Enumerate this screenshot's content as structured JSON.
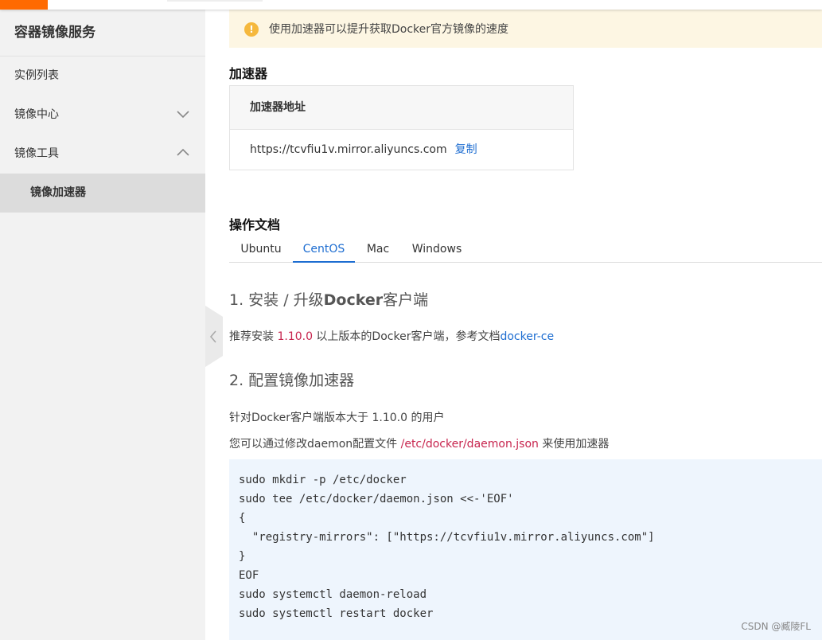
{
  "colors": {
    "accent": "#1d6dd1",
    "brand_orange": "#ff6a00",
    "code_red": "#c7254e",
    "warning": "#f5b83d"
  },
  "sidebar": {
    "title": "容器镜像服务",
    "items": [
      {
        "label": "实例列表"
      },
      {
        "label": "镜像中心",
        "icon": "chevron-down-icon"
      },
      {
        "label": "镜像工具",
        "icon": "chevron-up-icon"
      }
    ],
    "subitem": {
      "label": "镜像加速器"
    }
  },
  "notice": {
    "icon": "warning-icon",
    "text": "使用加速器可以提升获取Docker官方镜像的速度"
  },
  "accelerator": {
    "heading": "加速器",
    "table_header": "加速器地址",
    "address": "https://tcvfiu1v.mirror.aliyuncs.com",
    "copy_label": "复制"
  },
  "docs": {
    "heading": "操作文档",
    "tabs": [
      "Ubuntu",
      "CentOS",
      "Mac",
      "Windows"
    ],
    "active_tab": "CentOS",
    "step1": {
      "num": "1. 安装 / 升级",
      "bold": "Docker",
      "suffix": "客户端",
      "para_prefix": "推荐安装 ",
      "version": "1.10.0",
      "para_mid": " 以上版本的Docker客户端，参考文档",
      "link": "docker-ce"
    },
    "step2": {
      "title": "2. 配置镜像加速器",
      "para1": "针对Docker客户端版本大于 1.10.0 的用户",
      "para2_prefix": "您可以通过修改daemon配置文件 ",
      "path": "/etc/docker/daemon.json",
      "para2_suffix": " 来使用加速器"
    },
    "code": "sudo mkdir -p /etc/docker\nsudo tee /etc/docker/daemon.json <<-'EOF'\n{\n  \"registry-mirrors\": [\"https://tcvfiu1v.mirror.aliyuncs.com\"]\n}\nEOF\nsudo systemctl daemon-reload\nsudo systemctl restart docker"
  },
  "watermark": "CSDN @臧陵FL"
}
